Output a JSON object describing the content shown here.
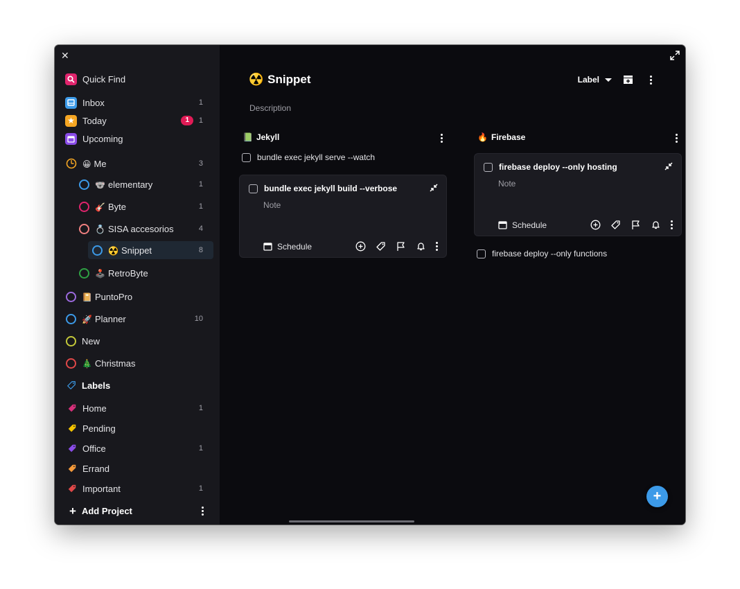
{
  "sidebar": {
    "quick_find": "Quick Find",
    "inbox": {
      "label": "Inbox",
      "count": "1"
    },
    "today": {
      "label": "Today",
      "badge": "1",
      "count": "1"
    },
    "upcoming": {
      "label": "Upcoming"
    },
    "projects": [
      {
        "label": "Me",
        "emoji": "😀",
        "count": "3",
        "color": "#f5a623"
      },
      {
        "label": "elementary",
        "emoji": "🐨",
        "count": "1",
        "color": "#3c9ae8"
      },
      {
        "label": "Byte",
        "emoji": "🎸",
        "count": "1",
        "color": "#e0246d"
      },
      {
        "label": "SISA accesorios",
        "emoji": "💍",
        "count": "4",
        "color": "#f08080"
      },
      {
        "label": "Snippet",
        "emoji": "☢️",
        "count": "8",
        "color": "#3c9ae8"
      },
      {
        "label": "RetroByte",
        "emoji": "🕹️",
        "count": "",
        "color": "#2ea043"
      },
      {
        "label": "PuntoPro",
        "emoji": "📔",
        "count": "",
        "color": "#9c6ade"
      },
      {
        "label": "Planner",
        "emoji": "🚀",
        "count": "10",
        "color": "#3c9ae8"
      },
      {
        "label": "New",
        "emoji": "",
        "count": "",
        "color": "#c4c93a"
      },
      {
        "label": "Christmas",
        "emoji": "🎄",
        "count": "",
        "color": "#e04848"
      }
    ],
    "labels_title": "Labels",
    "labels": [
      {
        "label": "Home",
        "count": "1",
        "color": "#d6307a"
      },
      {
        "label": "Pending",
        "count": "",
        "color": "#f5c400"
      },
      {
        "label": "Office",
        "count": "1",
        "color": "#8a4ce8"
      },
      {
        "label": "Errand",
        "count": "",
        "color": "#f59a3a"
      },
      {
        "label": "Important",
        "count": "1",
        "color": "#e04848"
      }
    ],
    "add_project": "Add Project"
  },
  "main": {
    "title": "Snippet",
    "title_emoji": "☢️",
    "description": "Description",
    "label_button": "Label",
    "columns": [
      {
        "name": "Jekyll",
        "emoji": "📗",
        "task": "bundle exec jekyll serve --watch",
        "card": {
          "title": "bundle exec jekyll build --verbose",
          "note": "Note",
          "schedule": "Schedule"
        }
      },
      {
        "name": "Firebase",
        "emoji": "🔥",
        "card": {
          "title": "firebase deploy --only hosting",
          "note": "Note",
          "schedule": "Schedule"
        },
        "task": "firebase deploy --only functions"
      }
    ]
  },
  "colors": {
    "accent": "#3c9ae8",
    "badge": "#e01b56",
    "sidebar_bg": "#18181d",
    "main_bg": "#0b0b0f"
  }
}
